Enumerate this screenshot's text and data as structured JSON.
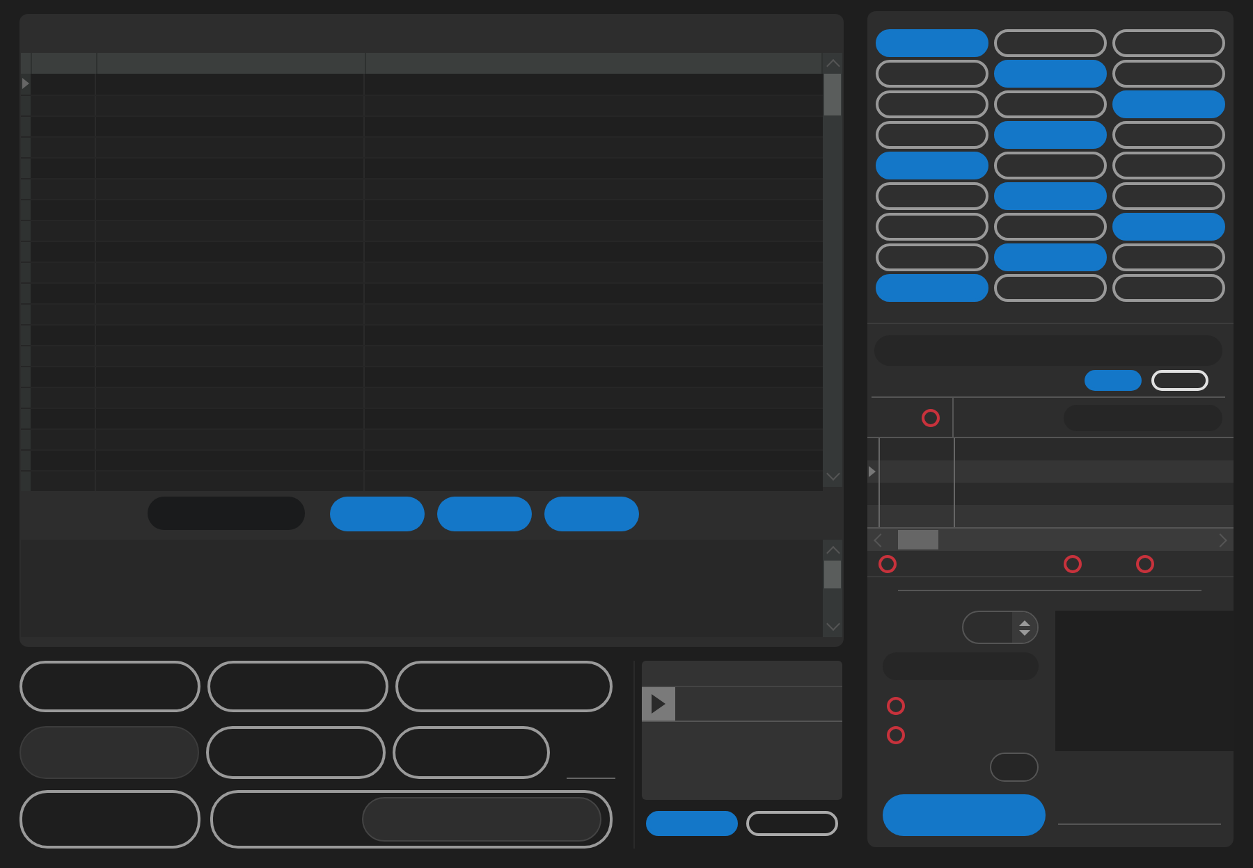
{
  "toggle_grid": [
    {
      "selected": true
    },
    {
      "selected": false
    },
    {
      "selected": false
    },
    {
      "selected": false
    },
    {
      "selected": true
    },
    {
      "selected": false
    },
    {
      "selected": false
    },
    {
      "selected": false
    },
    {
      "selected": true
    },
    {
      "selected": false
    },
    {
      "selected": true
    },
    {
      "selected": false
    },
    {
      "selected": true
    },
    {
      "selected": false
    },
    {
      "selected": false
    },
    {
      "selected": false
    },
    {
      "selected": true
    },
    {
      "selected": false
    },
    {
      "selected": false
    },
    {
      "selected": false
    },
    {
      "selected": true
    },
    {
      "selected": false
    },
    {
      "selected": true
    },
    {
      "selected": false
    },
    {
      "selected": true
    },
    {
      "selected": false
    },
    {
      "selected": false
    }
  ],
  "mode_toggle": [
    {
      "selected": true
    },
    {
      "selected": false
    }
  ],
  "action_toggle": [
    {
      "selected": true
    },
    {
      "selected": false
    }
  ],
  "radios": [
    {
      "checked": false
    },
    {
      "checked": false
    },
    {
      "checked": false
    },
    {
      "checked": false
    },
    {
      "checked": false
    },
    {
      "checked": false
    }
  ]
}
